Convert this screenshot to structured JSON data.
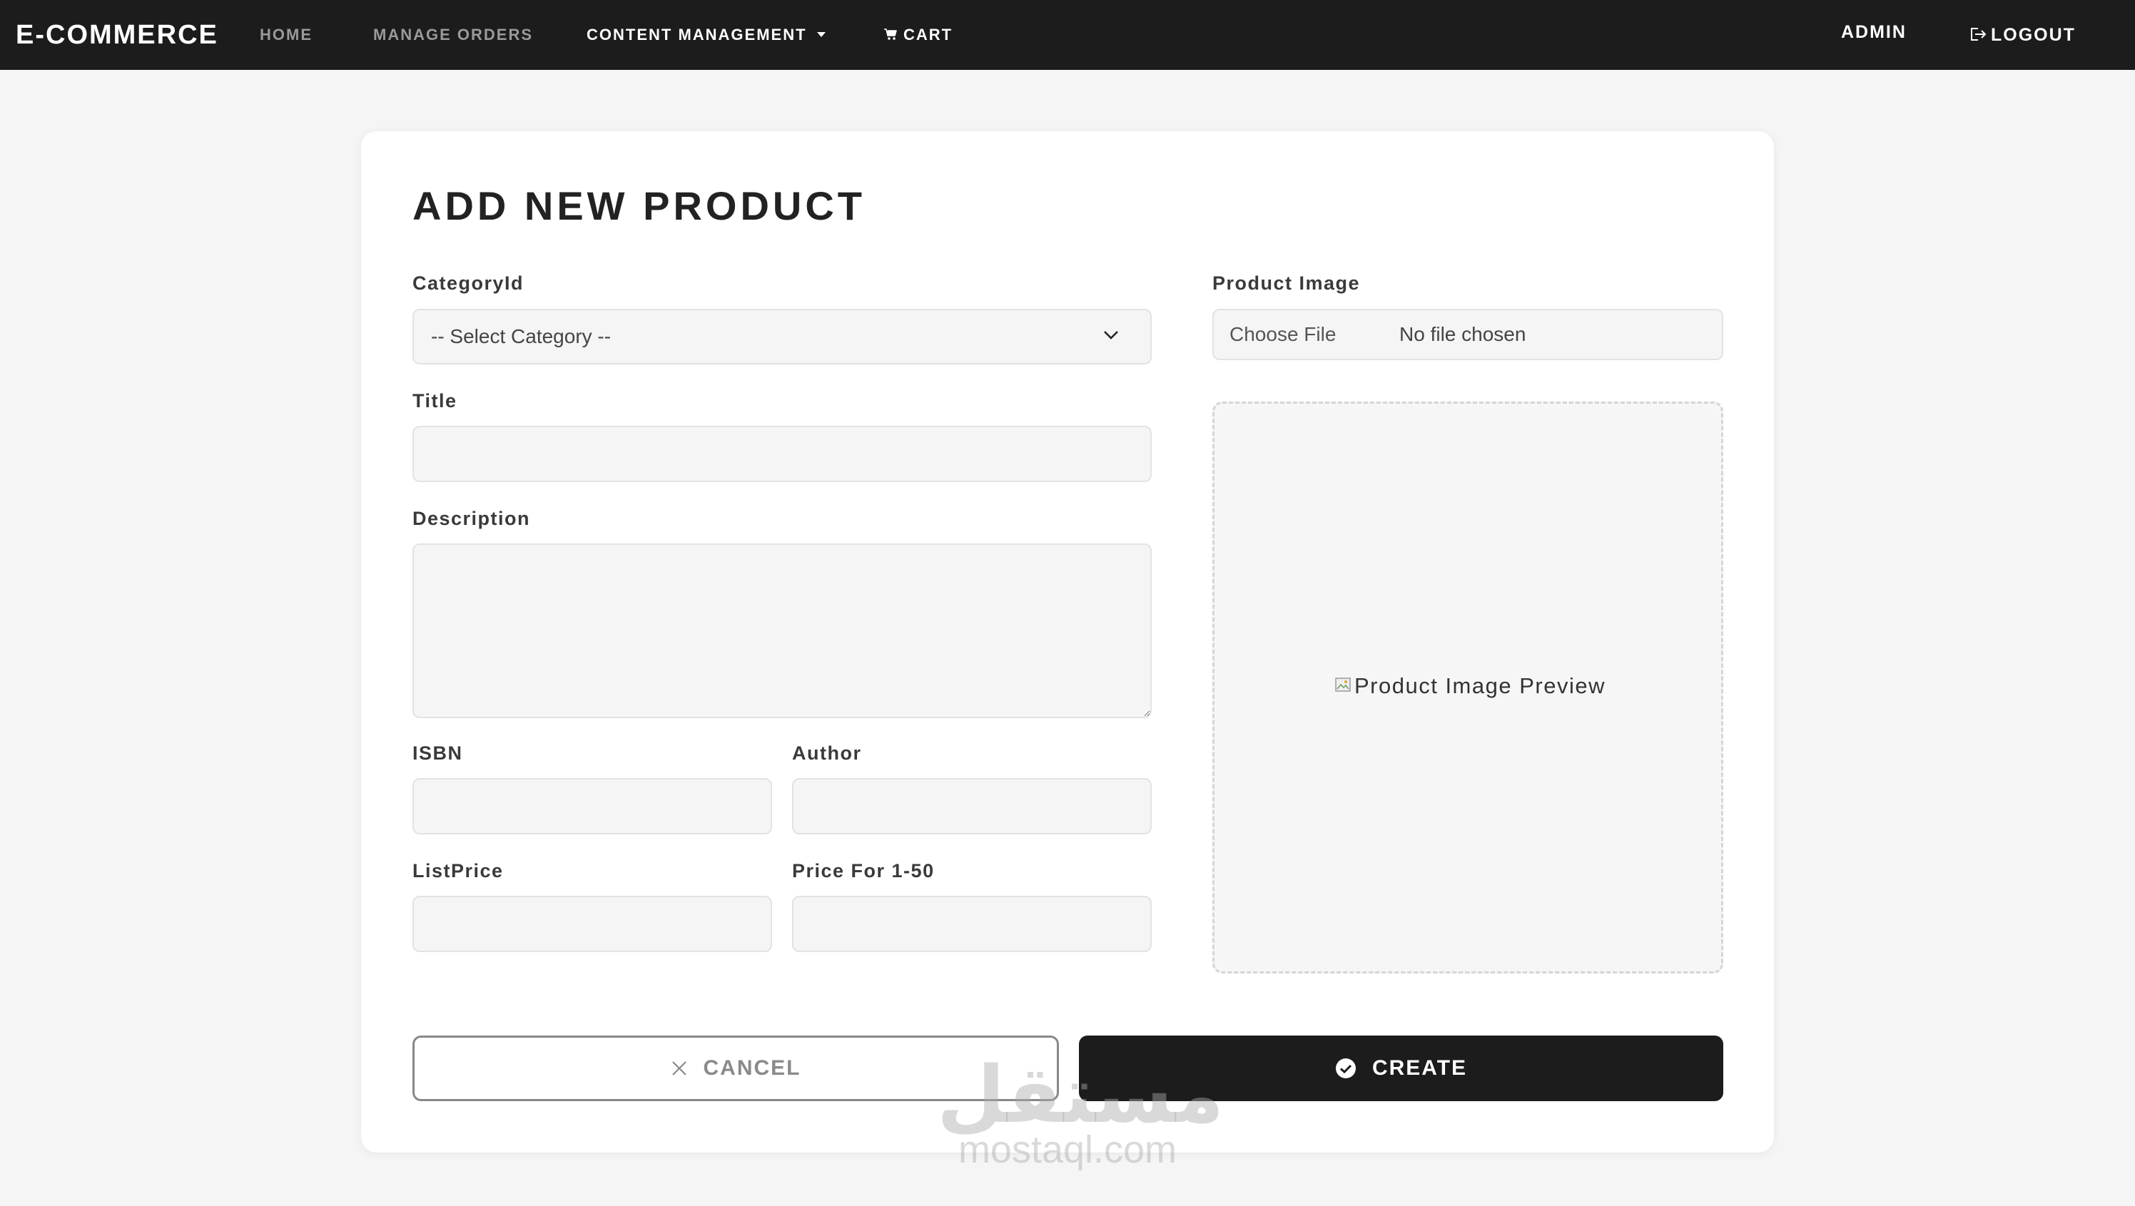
{
  "navbar": {
    "brand": "E-COMMERCE",
    "links": {
      "home": "HOME",
      "manage_orders": "MANAGE ORDERS",
      "content_management": "CONTENT MANAGEMENT",
      "cart": "CART"
    },
    "user": "ADMIN",
    "logout": "LOGOUT"
  },
  "form": {
    "title": "ADD NEW PRODUCT",
    "category": {
      "label": "CategoryId",
      "value": "-- Select Category --"
    },
    "title_field": {
      "label": "Title",
      "value": ""
    },
    "description": {
      "label": "Description",
      "value": ""
    },
    "isbn": {
      "label": "ISBN",
      "value": ""
    },
    "author": {
      "label": "Author",
      "value": ""
    },
    "list_price": {
      "label": "ListPrice",
      "value": ""
    },
    "price_1_50": {
      "label": "Price For 1-50",
      "value": ""
    },
    "product_image": {
      "label": "Product Image",
      "button": "Choose File",
      "status": "No file chosen",
      "preview_alt": "Product Image Preview"
    },
    "buttons": {
      "cancel": "CANCEL",
      "create": "CREATE"
    }
  },
  "watermark": {
    "arabic": "مستقل",
    "latin": "mostaql.com"
  },
  "colors": {
    "navbar_bg": "#1c1c1c",
    "page_bg": "#f5f5f6",
    "primary_button": "#1c1c1c",
    "muted_nav_link": "#9a9a9a"
  },
  "icons": [
    "cart-icon",
    "logout-icon",
    "chevron-down-icon",
    "close-icon",
    "check-circle-icon",
    "broken-image-icon",
    "caret-down-icon"
  ]
}
